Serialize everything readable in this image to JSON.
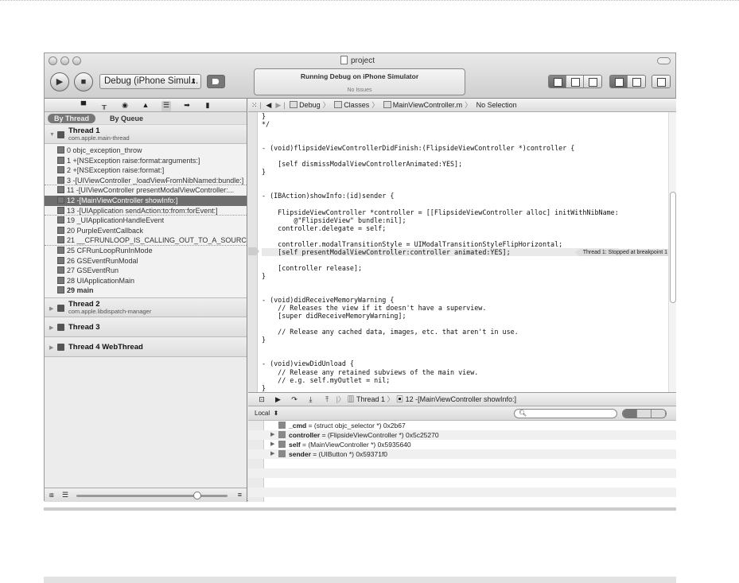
{
  "window": {
    "title": "project",
    "scheme": "Debug (iPhone Simul...",
    "activity": {
      "status": "Running Debug on iPhone Simulator",
      "issues": "No Issues"
    }
  },
  "navigator": {
    "icons": [
      "folder-icon",
      "hierarchy-icon",
      "search-icon",
      "warning-icon",
      "debug-icon",
      "breakpoint-icon",
      "log-icon"
    ],
    "tabs": [
      {
        "label": "By Thread",
        "active": true
      },
      {
        "label": "By Queue",
        "active": false
      }
    ],
    "thread1": {
      "name": "Thread 1",
      "queue": "com.apple.main-thread"
    },
    "frames": [
      {
        "label": "0 objc_exception_throw"
      },
      {
        "label": "1 +[NSException raise:format:arguments:]"
      },
      {
        "label": "2 +[NSException raise:format:]"
      },
      {
        "label": "3 -[UIViewController _loadViewFromNibNamed:bundle:]"
      },
      {
        "label": "11 -[UIViewController presentModalViewController:..."
      },
      {
        "label": "12 -[MainViewController showInfo:]",
        "selected": true
      },
      {
        "label": "13 -[UIApplication sendAction:to:from:forEvent:]"
      },
      {
        "label": "19 _UIApplicationHandleEvent"
      },
      {
        "label": "20 PurpleEventCallback"
      },
      {
        "label": "21 __CFRUNLOOP_IS_CALLING_OUT_TO_A_SOURCE1..."
      },
      {
        "label": "25 CFRunLoopRunInMode"
      },
      {
        "label": "26 GSEventRunModal"
      },
      {
        "label": "27 GSEventRun"
      },
      {
        "label": "28 UIApplicationMain"
      },
      {
        "label": "29 main"
      }
    ],
    "threads": [
      {
        "name": "Thread 2",
        "queue": "com.apple.libdispatch-manager"
      },
      {
        "name": "Thread 3"
      },
      {
        "name": "Thread 4 WebThread"
      }
    ],
    "slider_value": 0.8
  },
  "jumpbar": {
    "items": [
      "Debug",
      "Classes",
      "MainViewController.m",
      "No Selection"
    ]
  },
  "code": {
    "lines": [
      "}",
      "*/",
      "",
      "",
      "- (void)flipsideViewControllerDidFinish:(FlipsideViewController *)controller {",
      "",
      "    [self dismissModalViewControllerAnimated:YES];",
      "}",
      "",
      "",
      "- (IBAction)showInfo:(id)sender {",
      "",
      "    FlipsideViewController *controller = [[FlipsideViewController alloc] initWithNibName:",
      "        @\"FlipsideView\" bundle:nil];",
      "    controller.delegate = self;",
      "",
      "    controller.modalTransitionStyle = UIModalTransitionStyleFlipHorizontal;",
      "    [self presentModalViewController:controller animated:YES];",
      "",
      "    [controller release];",
      "}",
      "",
      "",
      "- (void)didReceiveMemoryWarning {",
      "    // Releases the view if it doesn't have a superview.",
      "    [super didReceiveMemoryWarning];",
      "",
      "    // Release any cached data, images, etc. that aren't in use.",
      "}",
      "",
      "",
      "- (void)viewDidUnload {",
      "    // Release any retained subviews of the main view.",
      "    // e.g. self.myOutlet = nil;",
      "}"
    ],
    "breakpoint_label": "Thread 1: Stopped at breakpoint 1"
  },
  "debugbar": {
    "thread": "Thread 1",
    "frame": "12 -[MainViewController showInfo:]"
  },
  "variables": {
    "scope": "Local",
    "search_placeholder": "",
    "rows": [
      {
        "name": "_cmd",
        "value": " = (struct objc_selector *) 0x2b67",
        "expandable": false
      },
      {
        "name": "controller",
        "value": " = (FlipsideViewController *) 0x5c25270",
        "expandable": true
      },
      {
        "name": "self",
        "value": " = (MainViewController *) 0x5935640",
        "expandable": true
      },
      {
        "name": "sender",
        "value": " = (UIButton *) 0x59371f0",
        "expandable": true
      }
    ]
  }
}
